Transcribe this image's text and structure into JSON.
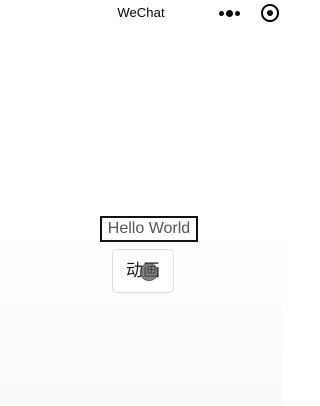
{
  "navbar": {
    "title": "WeChat",
    "more_icon": "more-dots-icon",
    "close_icon": "capsule-close-icon"
  },
  "main": {
    "hello_text": "Hello World",
    "animation_button_label": "动画",
    "touch_indicator_icon": "touch-indicator-icon"
  },
  "colors": {
    "background": "#ffffff",
    "box_border": "#111111",
    "hello_text": "#555555",
    "button_border": "#dcdcdc"
  }
}
